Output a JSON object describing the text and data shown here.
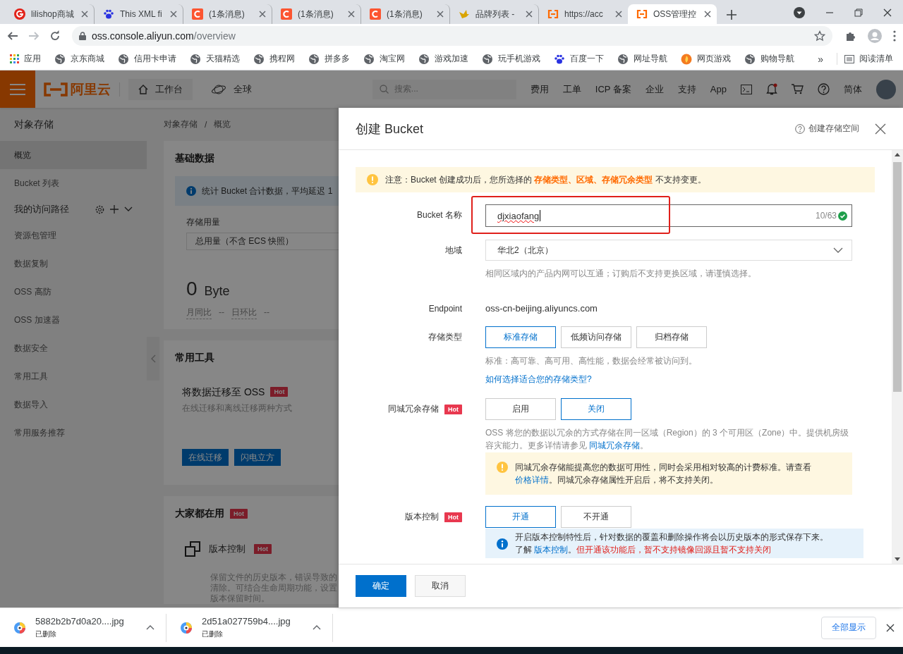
{
  "browser": {
    "tabs": [
      {
        "title": "lilishop商城",
        "selected": false
      },
      {
        "title": "This XML fi",
        "selected": false
      },
      {
        "title": "(1条消息)",
        "selected": false
      },
      {
        "title": "(1条消息)",
        "selected": false
      },
      {
        "title": "(1条消息)",
        "selected": false
      },
      {
        "title": "品牌列表 -",
        "selected": false
      },
      {
        "title": "https://acc",
        "selected": false
      },
      {
        "title": "OSS管理控",
        "selected": true
      }
    ],
    "url_host": "oss.console.aliyun.com",
    "url_path": "/overview",
    "bookmarks": [
      {
        "label": "应用",
        "kind": "apps"
      },
      {
        "label": "京东商城",
        "kind": "site"
      },
      {
        "label": "信用卡申请",
        "kind": "site"
      },
      {
        "label": "天猫精选",
        "kind": "site"
      },
      {
        "label": "携程网",
        "kind": "site"
      },
      {
        "label": "拼多多",
        "kind": "site"
      },
      {
        "label": "淘宝网",
        "kind": "site"
      },
      {
        "label": "游戏加速",
        "kind": "site"
      },
      {
        "label": "玩手机游戏",
        "kind": "site"
      },
      {
        "label": "百度一下",
        "kind": "paw"
      },
      {
        "label": "网址导航",
        "kind": "site"
      },
      {
        "label": "网页游戏",
        "kind": "flame"
      },
      {
        "label": "购物导航",
        "kind": "site"
      }
    ],
    "bookmarks_more": "»",
    "reading_list": "阅读清单"
  },
  "header": {
    "brand": "阿里云",
    "workbench": "工作台",
    "region": "全球",
    "search_placeholder": "搜索...",
    "links": [
      "费用",
      "工单",
      "ICP 备案",
      "企业",
      "支持",
      "App"
    ],
    "language": "简体"
  },
  "sidebar": {
    "title": "对象存储",
    "items": [
      {
        "label": "概览",
        "kind": "link",
        "selected": true
      },
      {
        "label": "Bucket 列表",
        "kind": "link",
        "selected": false
      },
      {
        "label": "我的访问路径",
        "kind": "section",
        "selected": false
      },
      {
        "label": "资源包管理",
        "kind": "link",
        "selected": false
      },
      {
        "label": "数据复制",
        "kind": "link",
        "selected": false
      },
      {
        "label": "OSS 高防",
        "kind": "link",
        "selected": false
      },
      {
        "label": "OSS 加速器",
        "kind": "link",
        "selected": false
      },
      {
        "label": "数据安全",
        "kind": "link",
        "selected": false
      },
      {
        "label": "常用工具",
        "kind": "link",
        "selected": false
      },
      {
        "label": "数据导入",
        "kind": "link",
        "selected": false
      },
      {
        "label": "常用服务推荐",
        "kind": "link",
        "selected": false
      }
    ]
  },
  "overview": {
    "breadcrumb": [
      "对象存储",
      "概览"
    ],
    "breadcrumb_separator": "/",
    "basic": {
      "title": "基础数据",
      "info": "统计 Bucket 合计数据，平均延迟 1",
      "usage_label": "存储用量",
      "usage_select": "总用量（不含 ECS 快照）",
      "value": "0",
      "unit": "Byte",
      "compare": [
        {
          "label": "月同比",
          "value": "--"
        },
        {
          "label": "日环比",
          "value": "--"
        }
      ]
    },
    "tools": {
      "title": "常用工具",
      "feature": "将数据迁移至 OSS",
      "tag": "Hot",
      "desc": "在线迁移和离线迁移两种方式",
      "buttons": [
        "在线迁移",
        "闪电立方"
      ]
    },
    "popular": {
      "title": "大家都在用",
      "tag": "Hot",
      "feature": "版本控制",
      "feature_tag": "Hot",
      "desc_lines": [
        "保留文件的历史版本，错误导致的",
        "清除。可结合生命周期功能，设置",
        "版本保留时间。"
      ]
    }
  },
  "drawer": {
    "title": "创建 Bucket",
    "help": "创建存储空间",
    "notice": "注意：Bucket 创建成功后，您所选择的 **存储类型、区域、存储冗余类型** 不支持变更。",
    "rows": [
      {
        "label": "Bucket 名称",
        "kind": "input",
        "value": "djxiaofang",
        "counter": "10/63",
        "valid": true,
        "highlighted": true
      },
      {
        "label": "地域",
        "kind": "select",
        "value": "华北2（北京）",
        "help": [
          {
            "kind": "text",
            "text": "相同区域内的产品内网可以互通；订购后不支持更换区域，请谨慎选择。"
          }
        ]
      },
      {
        "label": "Endpoint",
        "kind": "text",
        "value": "oss-cn-beijing.aliyuncs.com"
      },
      {
        "label": "存储类型",
        "kind": "choice",
        "options": [
          {
            "label": "标准存储",
            "selected": true
          },
          {
            "label": "低频访问存储",
            "selected": false
          },
          {
            "label": "归档存储",
            "selected": false
          }
        ],
        "help": [
          {
            "kind": "text",
            "text": "标准：高可靠、高可用、高性能，数据会经常被访问到。"
          }
        ],
        "link": "如何选择适合您的存储类型?"
      },
      {
        "label": "同城冗余存储",
        "tag": "Hot",
        "kind": "choice",
        "options": [
          {
            "label": "启用",
            "selected": false
          },
          {
            "label": "关闭",
            "selected": true
          }
        ],
        "help": [
          {
            "kind": "text",
            "text": "OSS 将您的数据以冗余的方式存储在同一区域（Region）的 3 个可用区（Zone）中。提供机房级容灾能力。更多详情请参见 "
          },
          {
            "kind": "link",
            "text": "同城冗余存储"
          },
          {
            "kind": "text",
            "text": "。"
          }
        ],
        "alert": {
          "kind": "warning",
          "lines": [
            [
              {
                "kind": "text",
                "text": "同城冗余存储能提高您的数据可用性，同时会采用相对较高的计费标准。请查看 "
              },
              {
                "kind": "link",
                "text": "价格详情"
              },
              {
                "kind": "text",
                "text": "。同城冗余存储属性开启后，将不支持关闭。"
              }
            ]
          ]
        }
      },
      {
        "label": "版本控制",
        "tag": "Hot",
        "kind": "choice",
        "options": [
          {
            "label": "开通",
            "selected": true
          },
          {
            "label": "不开通",
            "selected": false
          }
        ],
        "alert": {
          "kind": "info",
          "lines": [
            [
              {
                "kind": "text",
                "text": "开启版本控制特性后，针对数据的覆盖和删除操作将会以历史版本的形式保存下来。"
              }
            ],
            [
              {
                "kind": "text",
                "text": "了解 "
              },
              {
                "kind": "link",
                "text": "版本控制"
              },
              {
                "kind": "text",
                "text": "。"
              },
              {
                "kind": "danger",
                "text": "但开通该功能后，暂不支持镜像回源且暂不支持关闭"
              }
            ]
          ]
        }
      }
    ],
    "buttons": [
      {
        "label": "确定",
        "kind": "primary"
      },
      {
        "label": "取消",
        "kind": "default"
      }
    ]
  },
  "downloads": {
    "items": [
      {
        "file": "5882b2b7d0a20....jpg",
        "status": "已删除"
      },
      {
        "file": "2d51a027759b4....jpg",
        "status": "已删除"
      }
    ],
    "show_all": "全部显示"
  }
}
